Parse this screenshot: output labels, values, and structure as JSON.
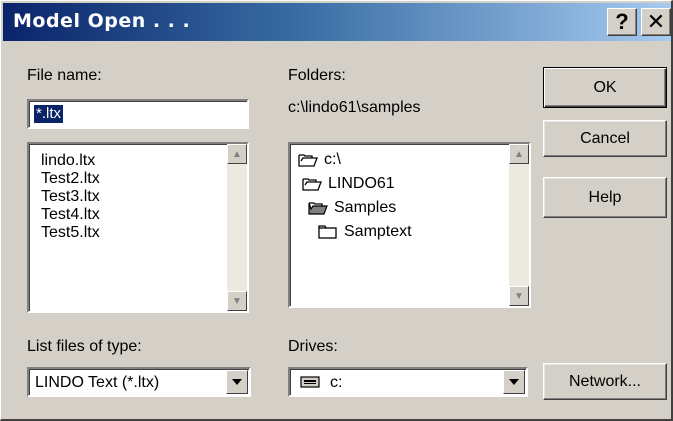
{
  "window": {
    "title": "Model Open . . .",
    "help_glyph": "?",
    "close_glyph": "✕"
  },
  "file_name": {
    "label": "File name:",
    "value": "*.ltx",
    "files": [
      "lindo.ltx",
      "Test2.ltx",
      "Test3.ltx",
      "Test4.ltx",
      "Test5.ltx"
    ]
  },
  "folders": {
    "label": "Folders:",
    "current_path": "c:\\lindo61\\samples",
    "tree": [
      {
        "name": "c:\\",
        "icon": "open-folder-icon"
      },
      {
        "name": "LINDO61",
        "icon": "open-folder-icon"
      },
      {
        "name": "Samples",
        "icon": "open-folder-selected-icon"
      },
      {
        "name": "Samptext",
        "icon": "closed-folder-icon"
      }
    ]
  },
  "file_type": {
    "label": "List files of type:",
    "selected": "LINDO Text (*.ltx)"
  },
  "drives": {
    "label": "Drives:",
    "selected": "c:",
    "icon": "drive-icon"
  },
  "buttons": {
    "ok": "OK",
    "cancel": "Cancel",
    "help": "Help",
    "network": "Network..."
  }
}
